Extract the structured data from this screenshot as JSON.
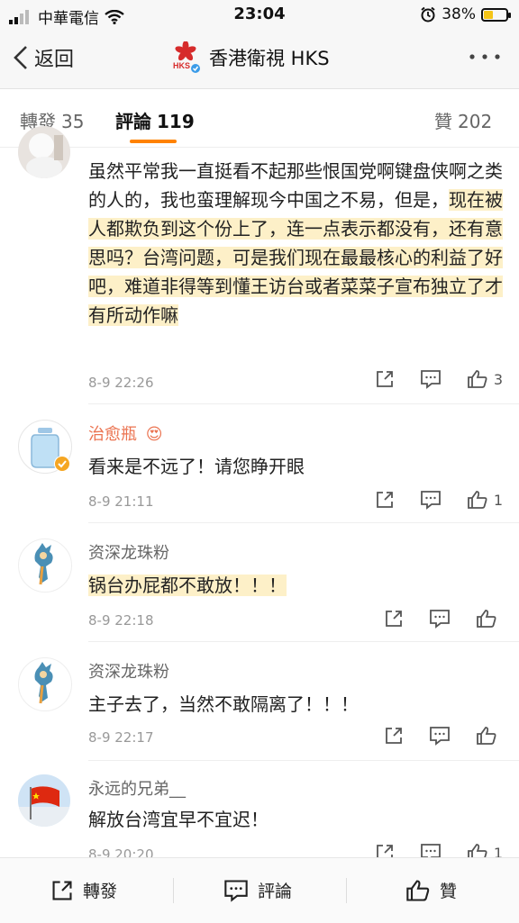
{
  "status_bar": {
    "carrier": "中華電信",
    "time": "23:04",
    "battery": "38%",
    "battery_level": 0.38
  },
  "header": {
    "back_label": "返回",
    "title": "香港衛視 HKS",
    "logo_text": "HKS"
  },
  "tabs": [
    {
      "label": "轉發",
      "count": "35"
    },
    {
      "label": "評論",
      "count": "119"
    },
    {
      "label": "贊",
      "count": "202"
    }
  ],
  "comments": [
    {
      "name": "",
      "text_plain": "虽然平常我一直挺看不起那些恨国党啊键盘侠啊之类的人的，我也蛮理解现今中国之不易，但是，",
      "text_highlight": "现在被人都欺负到这个份上了，连一点表示都没有，还有意思吗？台湾问题，可是我们现在最最核心的利益了好吧，难道非得等到懂王访台或者菜菜子宣布独立了才有所动作嘛",
      "time": "8-9 22:26",
      "likes": "3"
    },
    {
      "name": "治愈瓶",
      "name_badge": "😍",
      "text": "看来是不远了！请您睁开眼",
      "time": "8-9 21:11",
      "likes": "1"
    },
    {
      "name": "资深龙珠粉",
      "text": "锅台办屁都不敢放！！！",
      "time": "8-9 22:18",
      "likes": ""
    },
    {
      "name": "资深龙珠粉",
      "text": "主子去了，当然不敢隔离了！！！",
      "time": "8-9 22:17",
      "likes": ""
    },
    {
      "name": "永远的兄弟__",
      "text": "解放台湾宜早不宜迟！",
      "time": "8-9 20:20",
      "likes": "1"
    }
  ],
  "bottom_bar": {
    "repost": "轉發",
    "comment": "評論",
    "like": "贊"
  },
  "colors": {
    "accent": "#ff8200",
    "highlight": "#fdf0c8",
    "username_vip": "#eb7350"
  }
}
